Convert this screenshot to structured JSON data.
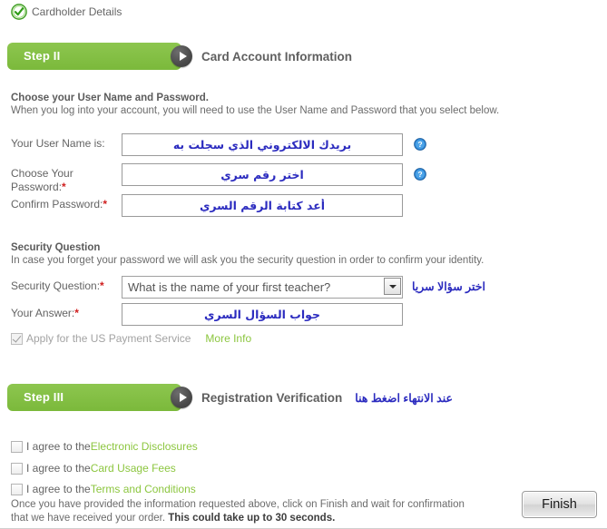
{
  "completed_step": {
    "icon": "green-check-circle-icon",
    "label": "Cardholder Details"
  },
  "step2": {
    "pill_label": "Step II",
    "arrow_icon": "play-arrow-circle-icon",
    "title": "Card Account Information"
  },
  "credentials_section": {
    "heading": "Choose your User Name and Password.",
    "subtext": "When you log into your account, you will need to use the User Name and Password that you select below.",
    "fields": [
      {
        "label": "Your User Name is:",
        "required": false,
        "value": "بريدك الالكتروني الذي سجلت به",
        "help_icon": "help-question-icon"
      },
      {
        "label": "Choose Your Password:",
        "required": true,
        "value": "اختر رقم سري",
        "help_icon": "help-question-icon"
      },
      {
        "label": "Confirm Password:",
        "required": true,
        "value": "أعد كتابة الرقم السري",
        "help_icon": null
      }
    ]
  },
  "security_section": {
    "heading": "Security Question",
    "subtext": "In case you forget your password we will ask you the security question in order to confirm your identity.",
    "question_label": "Security Question:",
    "question_required": true,
    "question_selected": "What is the name of your first teacher?",
    "question_note_arabic": "اختر سؤالا سريا",
    "answer_label": "Your Answer:",
    "answer_required": true,
    "answer_value": "جواب السؤال السري",
    "us_payment_checkbox_label": "Apply for the US Payment Service",
    "us_payment_checked": true,
    "us_payment_disabled": true,
    "more_info_link": "More Info"
  },
  "step3": {
    "pill_label": "Step III",
    "arrow_icon": "play-arrow-circle-icon",
    "title": "Registration Verification",
    "note_arabic": "عند الانتهاء اضغط هنا"
  },
  "agreements": [
    {
      "prefix": "I agree to the ",
      "link": "Electronic Disclosures",
      "checked": false
    },
    {
      "prefix": "I agree to the ",
      "link": "Card Usage Fees",
      "checked": false
    },
    {
      "prefix": "I agree to the ",
      "link": "Terms and Conditions",
      "checked": false
    }
  ],
  "footer": {
    "line1": "Once you have provided the information requested above, click on Finish and wait for confirmation",
    "line2_normal": "that we have received your order. ",
    "line2_bold": "This could take up to 30 seconds.",
    "finish_label": "Finish"
  },
  "colors": {
    "green_pill": "#82bd41",
    "green_link": "#8cc63f",
    "green_check": "#4aa02c",
    "arabic_blue": "#2b2bbf",
    "required_red": "#d02020",
    "label_gray": "#646464"
  }
}
